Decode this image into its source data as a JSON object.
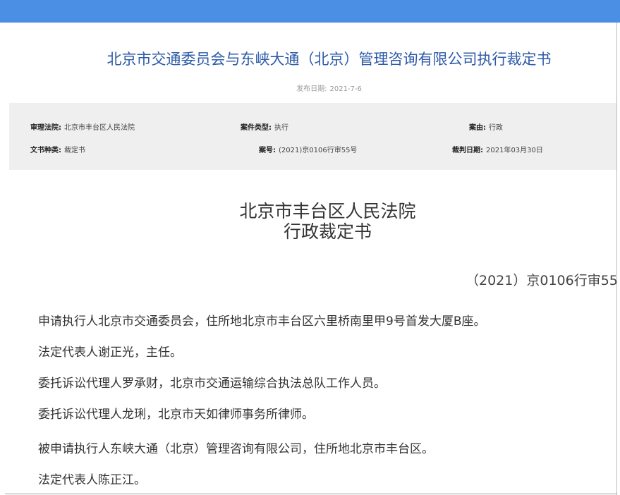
{
  "header": {
    "title": "北京市交通委员会与东峡大通（北京）管理咨询有限公司执行裁定书",
    "publish_label": "发布日期:",
    "publish_date": "2021-7-6"
  },
  "meta": {
    "court_label": "审理法院:",
    "court_value": "北京市丰台区人民法院",
    "case_type_label": "案件类型:",
    "case_type_value": "执行",
    "cause_label": "案由:",
    "cause_value": "行政",
    "doc_type_label": "文书种类:",
    "doc_type_value": "裁定书",
    "case_no_label": "案号:",
    "case_no_value": "(2021)京0106行审55号",
    "judgment_date_label": "裁判日期:",
    "judgment_date_value": "2021年03月30日"
  },
  "document": {
    "court_name": "北京市丰台区人民法院",
    "doc_kind": "行政裁定书",
    "case_number": "（2021）京0106行审55",
    "paragraphs": [
      "申请执行人北京市交通委员会，住所地北京市丰台区六里桥南里甲9号首发大厦B座。",
      "法定代表人谢正光，主任。",
      "委托诉讼代理人罗承财，北京市交通运输综合执法总队工作人员。",
      "委托诉讼代理人龙琍，北京市天如律师事务所律师。",
      "被申请执行人东峡大通（北京）管理咨询有限公司，住所地北京市丰台区。",
      "法定代表人陈正江。"
    ]
  },
  "colors": {
    "topbar": "#4a8fe4",
    "title": "#2d5aa8",
    "panel": "#efefef"
  }
}
